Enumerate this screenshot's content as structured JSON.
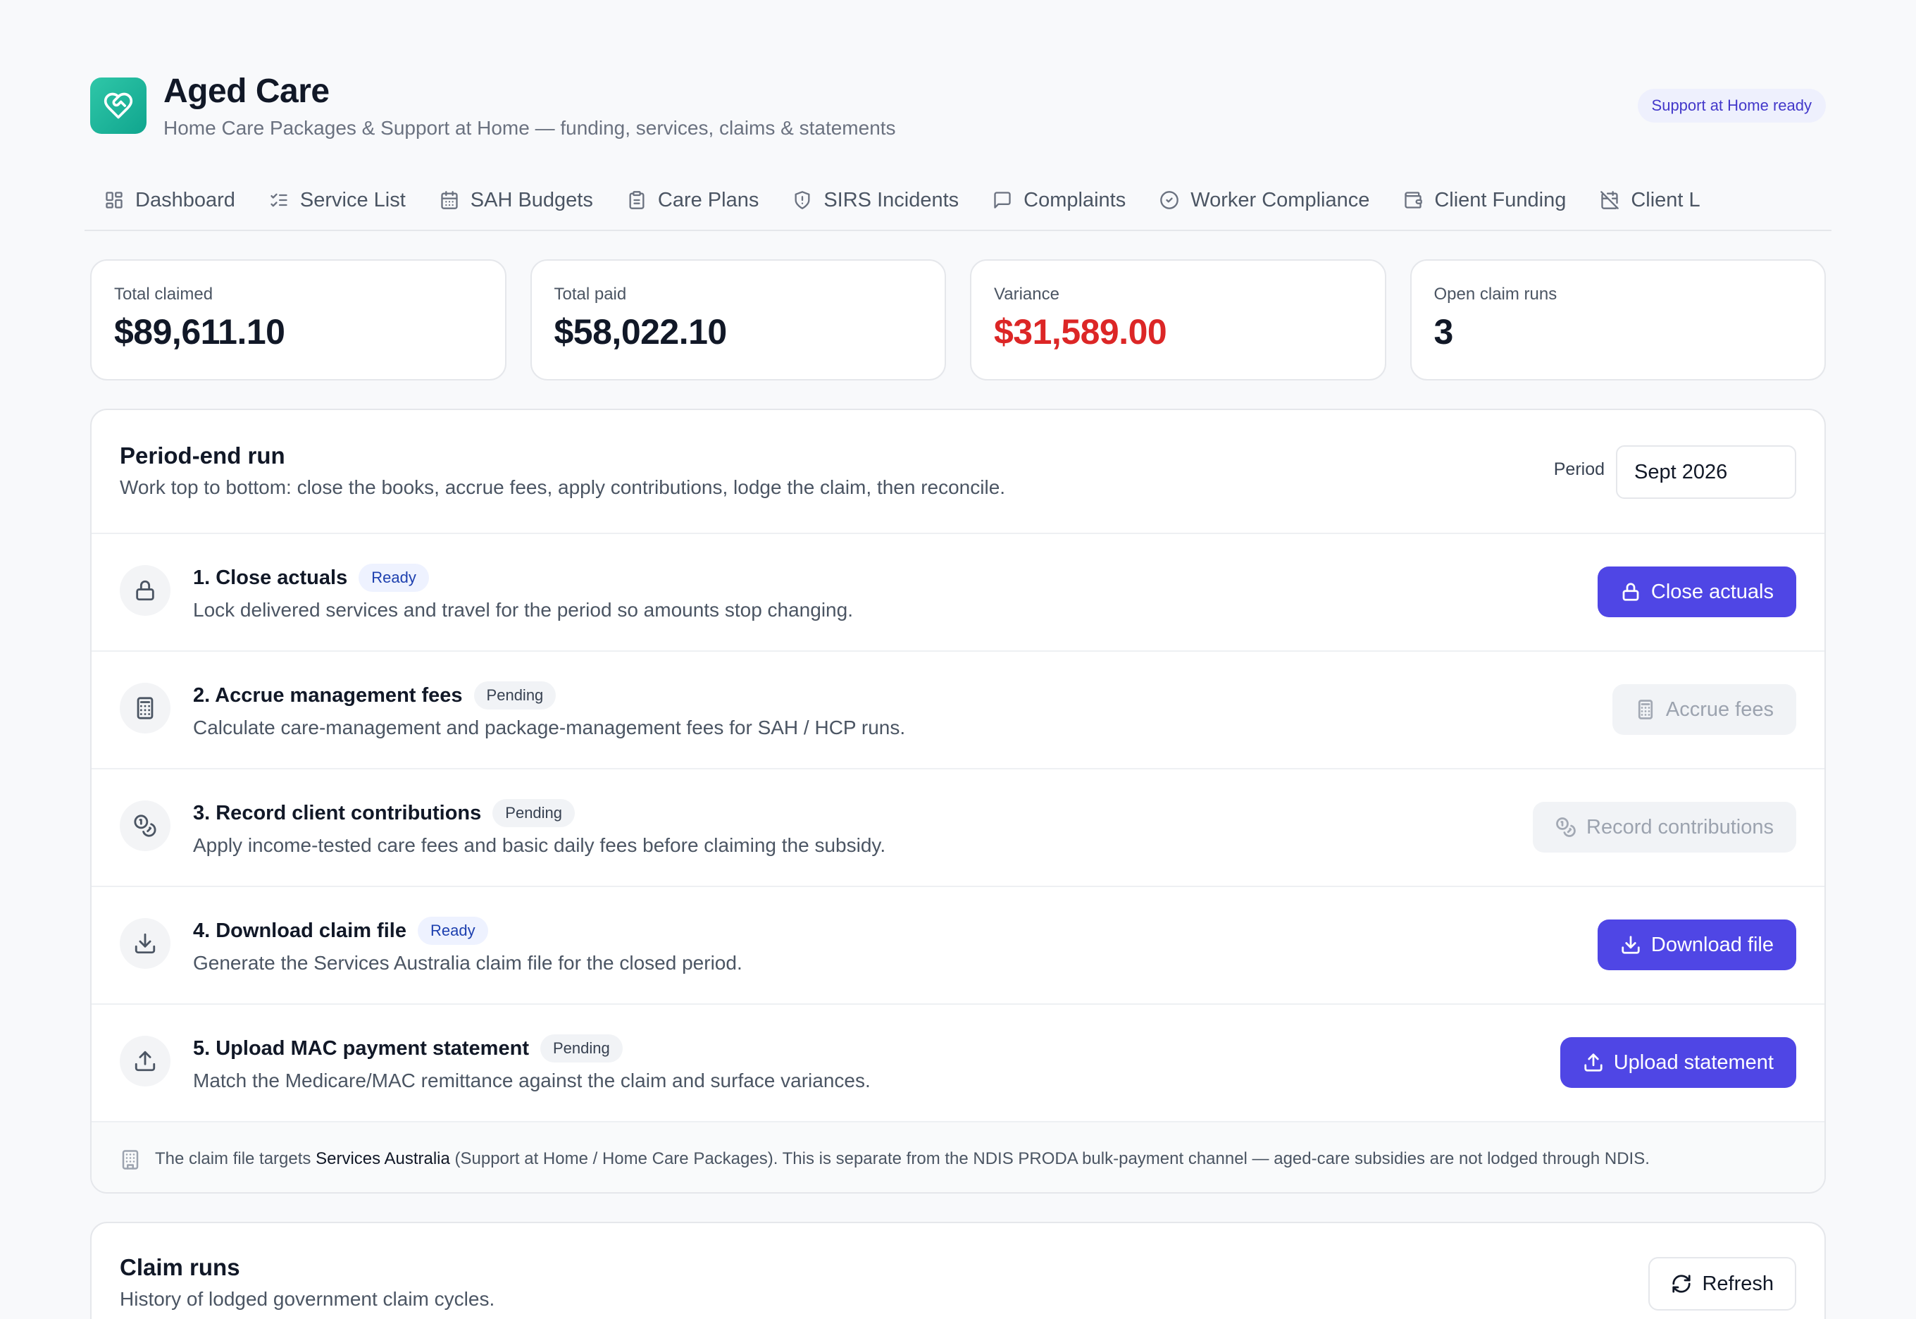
{
  "app": {
    "title": "Aged Care",
    "subtitle": "Home Care Packages & Support at Home — funding, services, claims & statements",
    "ready_badge": "Support at Home ready",
    "logo_icon": "heart-handshake-icon"
  },
  "tabs": [
    {
      "label": "Dashboard",
      "icon": "dashboard-icon"
    },
    {
      "label": "Service List",
      "icon": "list-checks-icon"
    },
    {
      "label": "SAH Budgets",
      "icon": "calendar-icon"
    },
    {
      "label": "Care Plans",
      "icon": "clipboard-icon"
    },
    {
      "label": "SIRS Incidents",
      "icon": "shield-alert-icon"
    },
    {
      "label": "Complaints",
      "icon": "message-square-icon"
    },
    {
      "label": "Worker Compliance",
      "icon": "check-circle-icon"
    },
    {
      "label": "Client Funding",
      "icon": "wallet-icon"
    },
    {
      "label": "Client L",
      "icon": "calendar-off-icon"
    }
  ],
  "stats": [
    {
      "label": "Total claimed",
      "value": "$89,611.10"
    },
    {
      "label": "Total paid",
      "value": "$58,022.10"
    },
    {
      "label": "Variance",
      "value": "$31,589.00",
      "color": "#dc2626"
    },
    {
      "label": "Open claim runs",
      "value": "3"
    }
  ],
  "run": {
    "title": "Period-end run",
    "description": "Work top to bottom: close the books, accrue fees, apply contributions, lodge the claim, then reconcile.",
    "period_label": "Period",
    "period_value": "Sept 2026",
    "steps": [
      {
        "title": "1. Close actuals",
        "status": "Ready",
        "description": "Lock delivered services and travel for the period so amounts stop changing.",
        "button": "Close actuals",
        "icon": "lock-icon",
        "enabled": true
      },
      {
        "title": "2. Accrue management fees",
        "status": "Pending",
        "description": "Calculate care-management and package-management fees for SAH / HCP runs.",
        "button": "Accrue fees",
        "icon": "calculator-icon",
        "enabled": false
      },
      {
        "title": "3. Record client contributions",
        "status": "Pending",
        "description": "Apply income-tested care fees and basic daily fees before claiming the subsidy.",
        "button": "Record contributions",
        "icon": "coins-icon",
        "enabled": false
      },
      {
        "title": "4. Download claim file",
        "status": "Ready",
        "description": "Generate the Services Australia claim file for the closed period.",
        "button": "Download file",
        "icon": "download-icon",
        "enabled": true
      },
      {
        "title": "5. Upload MAC payment statement",
        "status": "Pending",
        "description": "Match the Medicare/MAC remittance against the claim and surface variances.",
        "button": "Upload statement",
        "icon": "upload-icon",
        "enabled": true
      }
    ],
    "footer": {
      "prefix": "The claim file targets ",
      "emphasis": "Services Australia",
      "suffix": " (Support at Home / Home Care Packages). This is separate from the NDIS PRODA bulk-payment channel — aged-care subsidies are not lodged through NDIS.",
      "icon": "building-icon"
    }
  },
  "claims": {
    "title": "Claim runs",
    "description": "History of lodged government claim cycles.",
    "refresh_label": "Refresh"
  },
  "colors": {
    "accent": "#4f46e5",
    "logo": "#1fb89b",
    "danger": "#dc2626"
  }
}
